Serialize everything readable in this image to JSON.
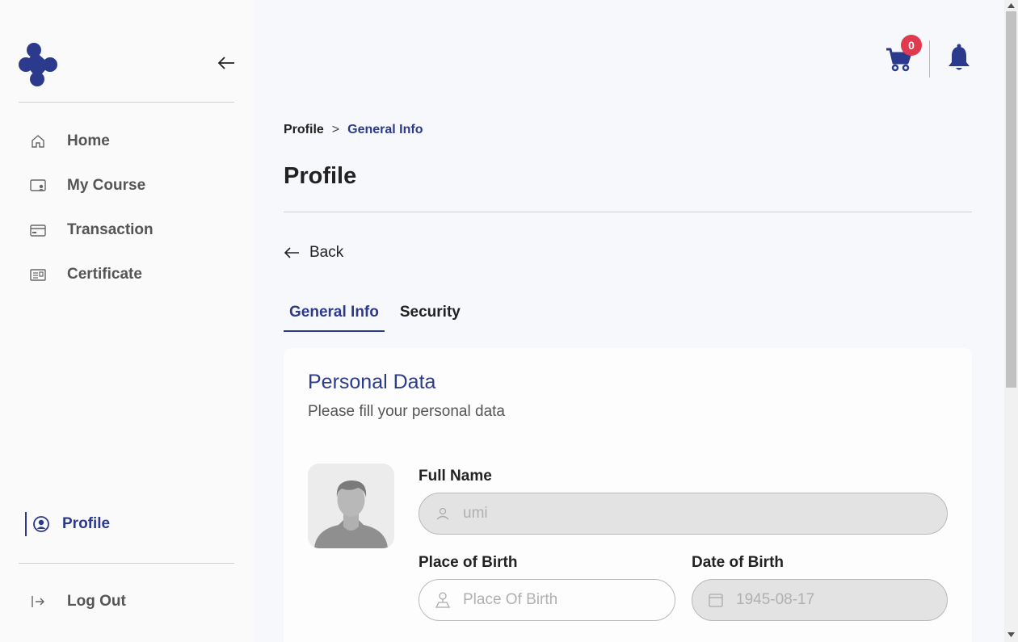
{
  "sidebar": {
    "items": [
      {
        "label": "Home",
        "icon": "home-icon"
      },
      {
        "label": "My Course",
        "icon": "course-icon"
      },
      {
        "label": "Transaction",
        "icon": "card-icon"
      },
      {
        "label": "Certificate",
        "icon": "certificate-icon"
      }
    ],
    "profile_label": "Profile",
    "logout_label": "Log Out"
  },
  "header": {
    "cart_count": "0"
  },
  "breadcrumb": {
    "root": "Profile",
    "separator": ">",
    "current": "General Info"
  },
  "page": {
    "title": "Profile",
    "back_label": "Back"
  },
  "tabs": [
    {
      "label": "General Info",
      "active": true
    },
    {
      "label": "Security",
      "active": false
    }
  ],
  "personal_data": {
    "title": "Personal Data",
    "subtitle": "Please fill your personal data",
    "full_name": {
      "label": "Full Name",
      "value": "umi"
    },
    "place_of_birth": {
      "label": "Place of Birth",
      "placeholder": "Place Of Birth"
    },
    "date_of_birth": {
      "label": "Date of Birth",
      "value": "1945-08-17"
    }
  },
  "colors": {
    "accent": "#2b3a8c",
    "badge": "#e03a4e"
  }
}
